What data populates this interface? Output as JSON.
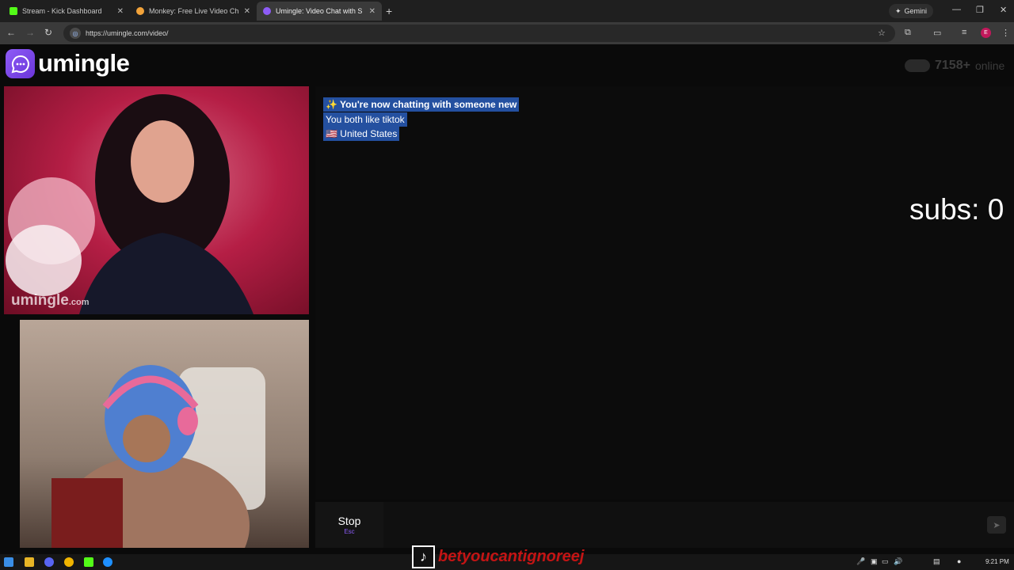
{
  "browser": {
    "tabs": [
      {
        "title": "Stream - Kick Dashboard",
        "fav_color": "#53fc18"
      },
      {
        "title": "Monkey: Free Live Video Ch",
        "fav_color": "#f2a33a"
      },
      {
        "title": "Umingle: Video Chat with S",
        "fav_color": "#8e5cf7"
      }
    ],
    "gemini_label": "Gemini",
    "url": "https://umingle.com/video/",
    "profile_initial": "E"
  },
  "site": {
    "logo": "umingle",
    "online_count": "7158+",
    "online_label": "online",
    "watermark_main": "umingle",
    "watermark_suffix": ".com"
  },
  "chat": {
    "messages": [
      "✨ You're now chatting with someone new",
      "You both like tiktok",
      "🇺🇸 United States"
    ],
    "stop_label": "Stop",
    "stop_hint": "Esc"
  },
  "overlay": {
    "subs_text": "subs: 0",
    "tiktok_handle": "betyoucantignoreej"
  },
  "taskbar": {
    "time": "9:21 PM"
  }
}
